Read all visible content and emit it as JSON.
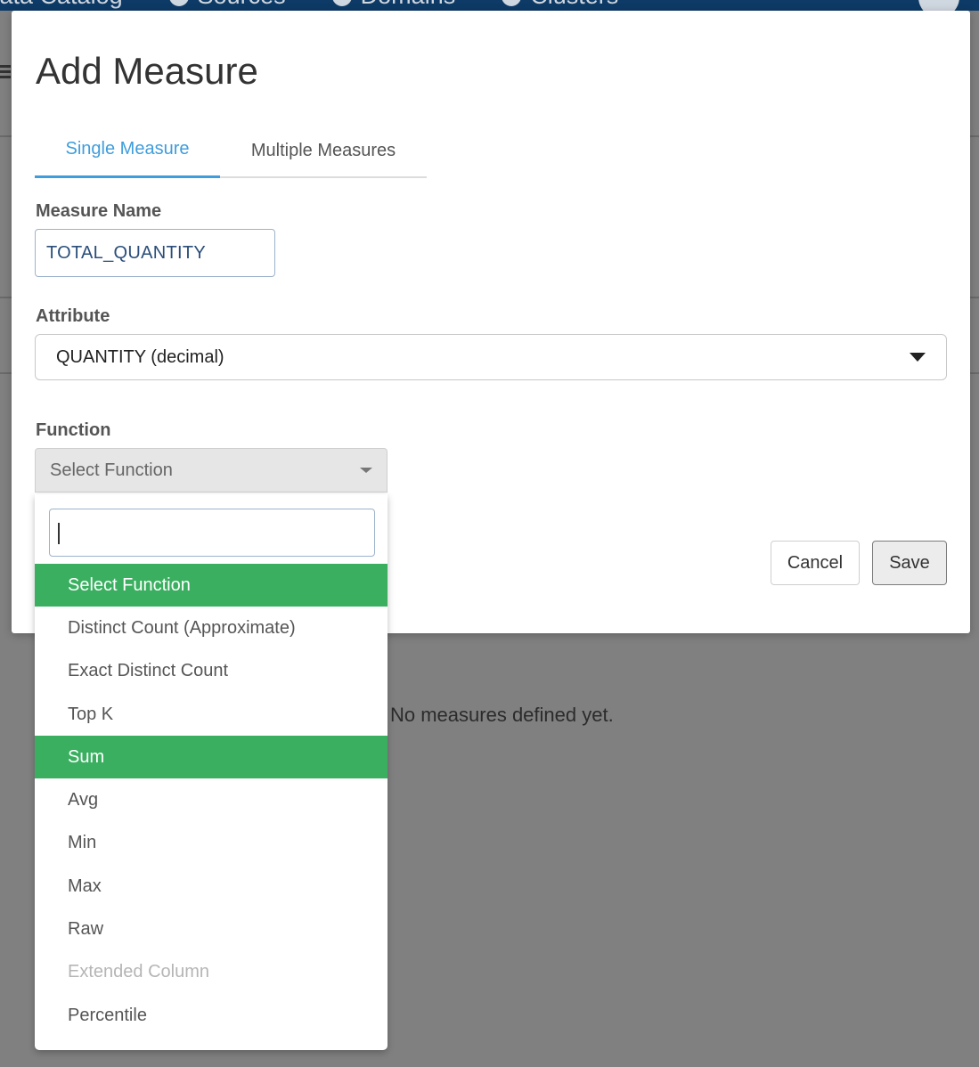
{
  "background": {
    "nav": [
      "Data Catalog",
      "Sources",
      "Domains",
      "Clusters"
    ],
    "empty_message": "No measures defined yet."
  },
  "modal": {
    "title": "Add Measure",
    "tabs": [
      {
        "label": "Single Measure",
        "active": true
      },
      {
        "label": "Multiple Measures",
        "active": false
      }
    ],
    "measure_name": {
      "label": "Measure Name",
      "value": "TOTAL_QUANTITY"
    },
    "attribute": {
      "label": "Attribute",
      "value": "QUANTITY (decimal)"
    },
    "function": {
      "label": "Function",
      "value": "Select Function"
    },
    "buttons": {
      "cancel": "Cancel",
      "save": "Save"
    }
  },
  "function_dropdown": {
    "search_value": "",
    "options": [
      {
        "label": "Select Function",
        "state": "highlight"
      },
      {
        "label": "Distinct Count (Approximate)",
        "state": "normal"
      },
      {
        "label": "Exact Distinct Count",
        "state": "normal"
      },
      {
        "label": "Top K",
        "state": "normal"
      },
      {
        "label": "Sum",
        "state": "highlight"
      },
      {
        "label": "Avg",
        "state": "normal"
      },
      {
        "label": "Min",
        "state": "normal"
      },
      {
        "label": "Max",
        "state": "normal"
      },
      {
        "label": "Raw",
        "state": "normal"
      },
      {
        "label": "Extended Column",
        "state": "disabled"
      },
      {
        "label": "Percentile",
        "state": "normal"
      }
    ]
  },
  "colors": {
    "highlight": "#3aaf60",
    "tab_active": "#3f9ddc",
    "overlay": "#808080",
    "topbar": "#0d3a66"
  }
}
